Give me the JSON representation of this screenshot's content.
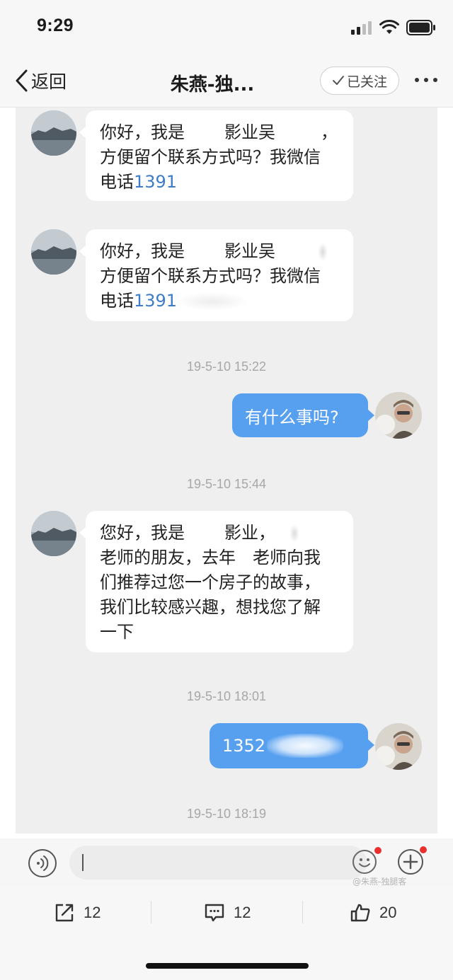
{
  "status_bar": {
    "time": "9:29"
  },
  "nav": {
    "back_label": "返回",
    "title": "朱燕-独...",
    "follow_label": "已关注"
  },
  "messages": [
    {
      "direction": "incoming",
      "lines": [
        {
          "a": "你好，我是",
          "b": "影业吴",
          "c": "，"
        },
        {
          "a": "方便留个联系方式吗？我微信"
        },
        {
          "a": "电话",
          "link": "1391"
        }
      ]
    },
    {
      "direction": "incoming",
      "lines": [
        {
          "a": "你好，我是",
          "b": "影业吴"
        },
        {
          "a": "方便留个联系方式吗？我微信"
        },
        {
          "a": "电话",
          "link": "1391"
        }
      ]
    },
    {
      "timestamp": "19-5-10 15:22"
    },
    {
      "direction": "outgoing",
      "text": "有什么事吗?"
    },
    {
      "timestamp": "19-5-10 15:44"
    },
    {
      "direction": "incoming",
      "lines": [
        {
          "a": "您好，我是",
          "b": "影业，"
        },
        {
          "a": "老师的朋友，去年",
          "b": "老师向我"
        },
        {
          "a": "们推荐过您一个房子的故事，"
        },
        {
          "a": "我们比较感兴趣，想找您了解"
        },
        {
          "a": "一下"
        }
      ]
    },
    {
      "timestamp": "19-5-10 18:01"
    },
    {
      "direction": "outgoing",
      "text": "1352"
    },
    {
      "timestamp": "19-5-10 18:19"
    }
  ],
  "input": {
    "placeholder": ""
  },
  "watermark": "@朱燕-独腿客",
  "actions": {
    "share_count": "12",
    "comment_count": "12",
    "like_count": "20"
  },
  "colors": {
    "outgoing_bubble": "#57a0f0",
    "incoming_bubble": "#ffffff",
    "chat_background": "#efefef",
    "link": "#3d7cc8"
  }
}
